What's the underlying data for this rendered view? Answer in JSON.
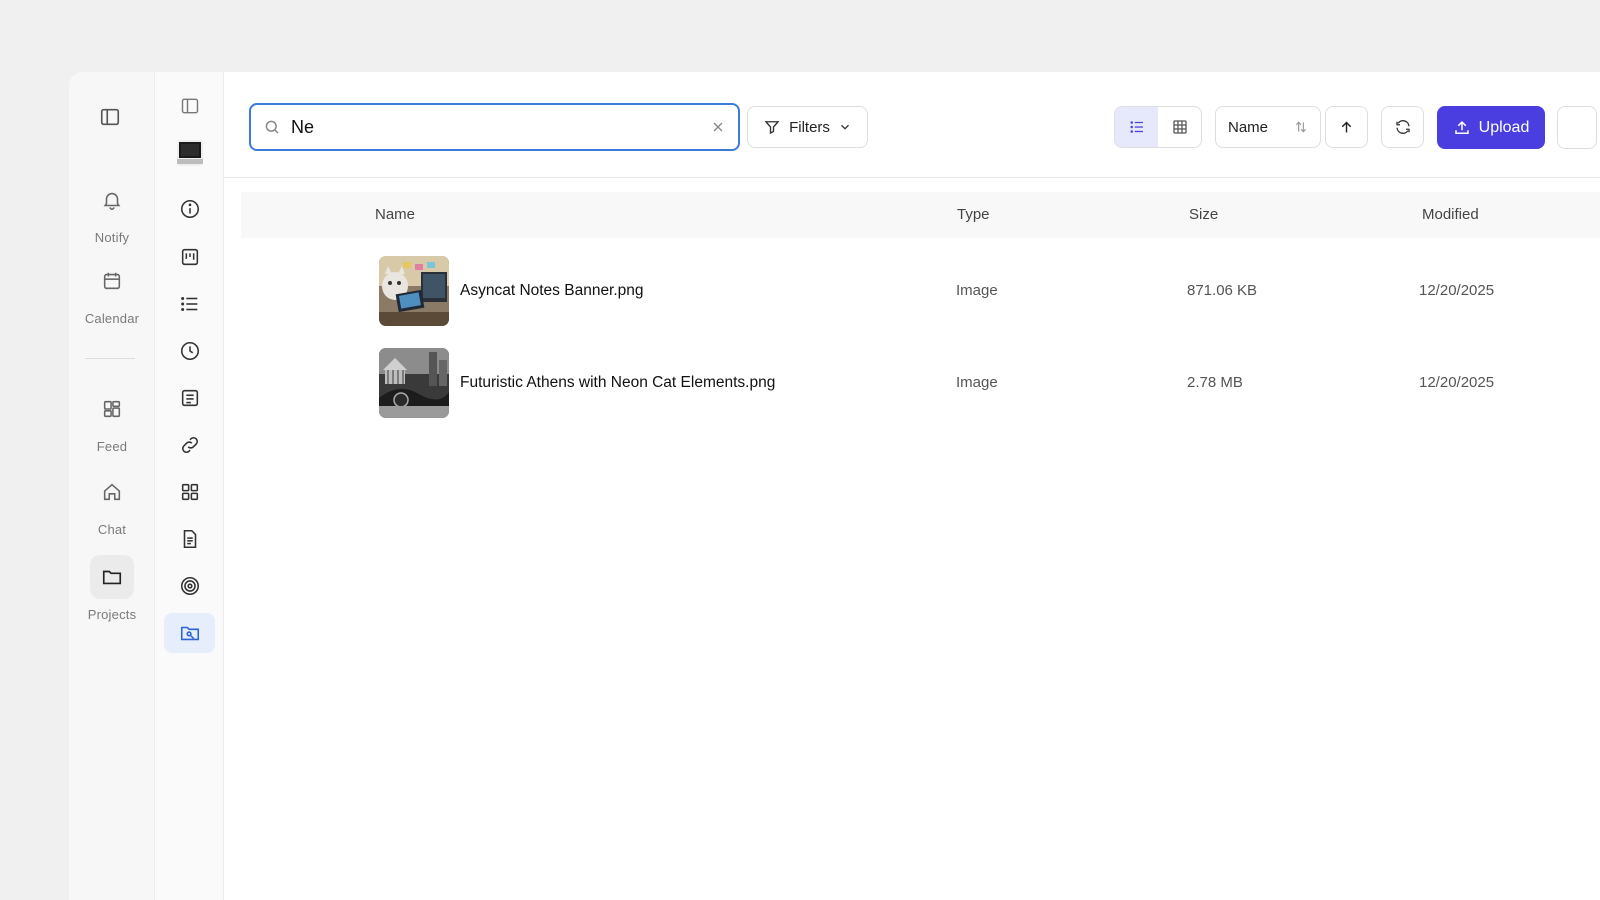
{
  "rail": {
    "items": [
      {
        "label": "Notify",
        "icon": "bell-icon"
      },
      {
        "label": "Calendar",
        "icon": "calendar-icon"
      },
      {
        "label": "Feed",
        "icon": "grid-icon"
      },
      {
        "label": "Chat",
        "icon": "home-icon"
      },
      {
        "label": "Projects",
        "icon": "folder-icon"
      }
    ]
  },
  "toolbar": {
    "search_value": "Ne",
    "filters_label": "Filters",
    "sort_label": "Name",
    "upload_label": "Upload"
  },
  "table": {
    "headers": {
      "name": "Name",
      "type": "Type",
      "size": "Size",
      "modified": "Modified"
    },
    "rows": [
      {
        "name": "Asyncat Notes Banner.png",
        "type": "Image",
        "size": "871.06 KB",
        "modified": "12/20/2025"
      },
      {
        "name": "Futuristic Athens with Neon Cat Elements.png",
        "type": "Image",
        "size": "2.78 MB",
        "modified": "12/20/2025"
      }
    ]
  },
  "colors": {
    "accent": "#4a3ee0",
    "search_border": "#3d7bd8",
    "active_sidebar": "#2f63d6"
  }
}
